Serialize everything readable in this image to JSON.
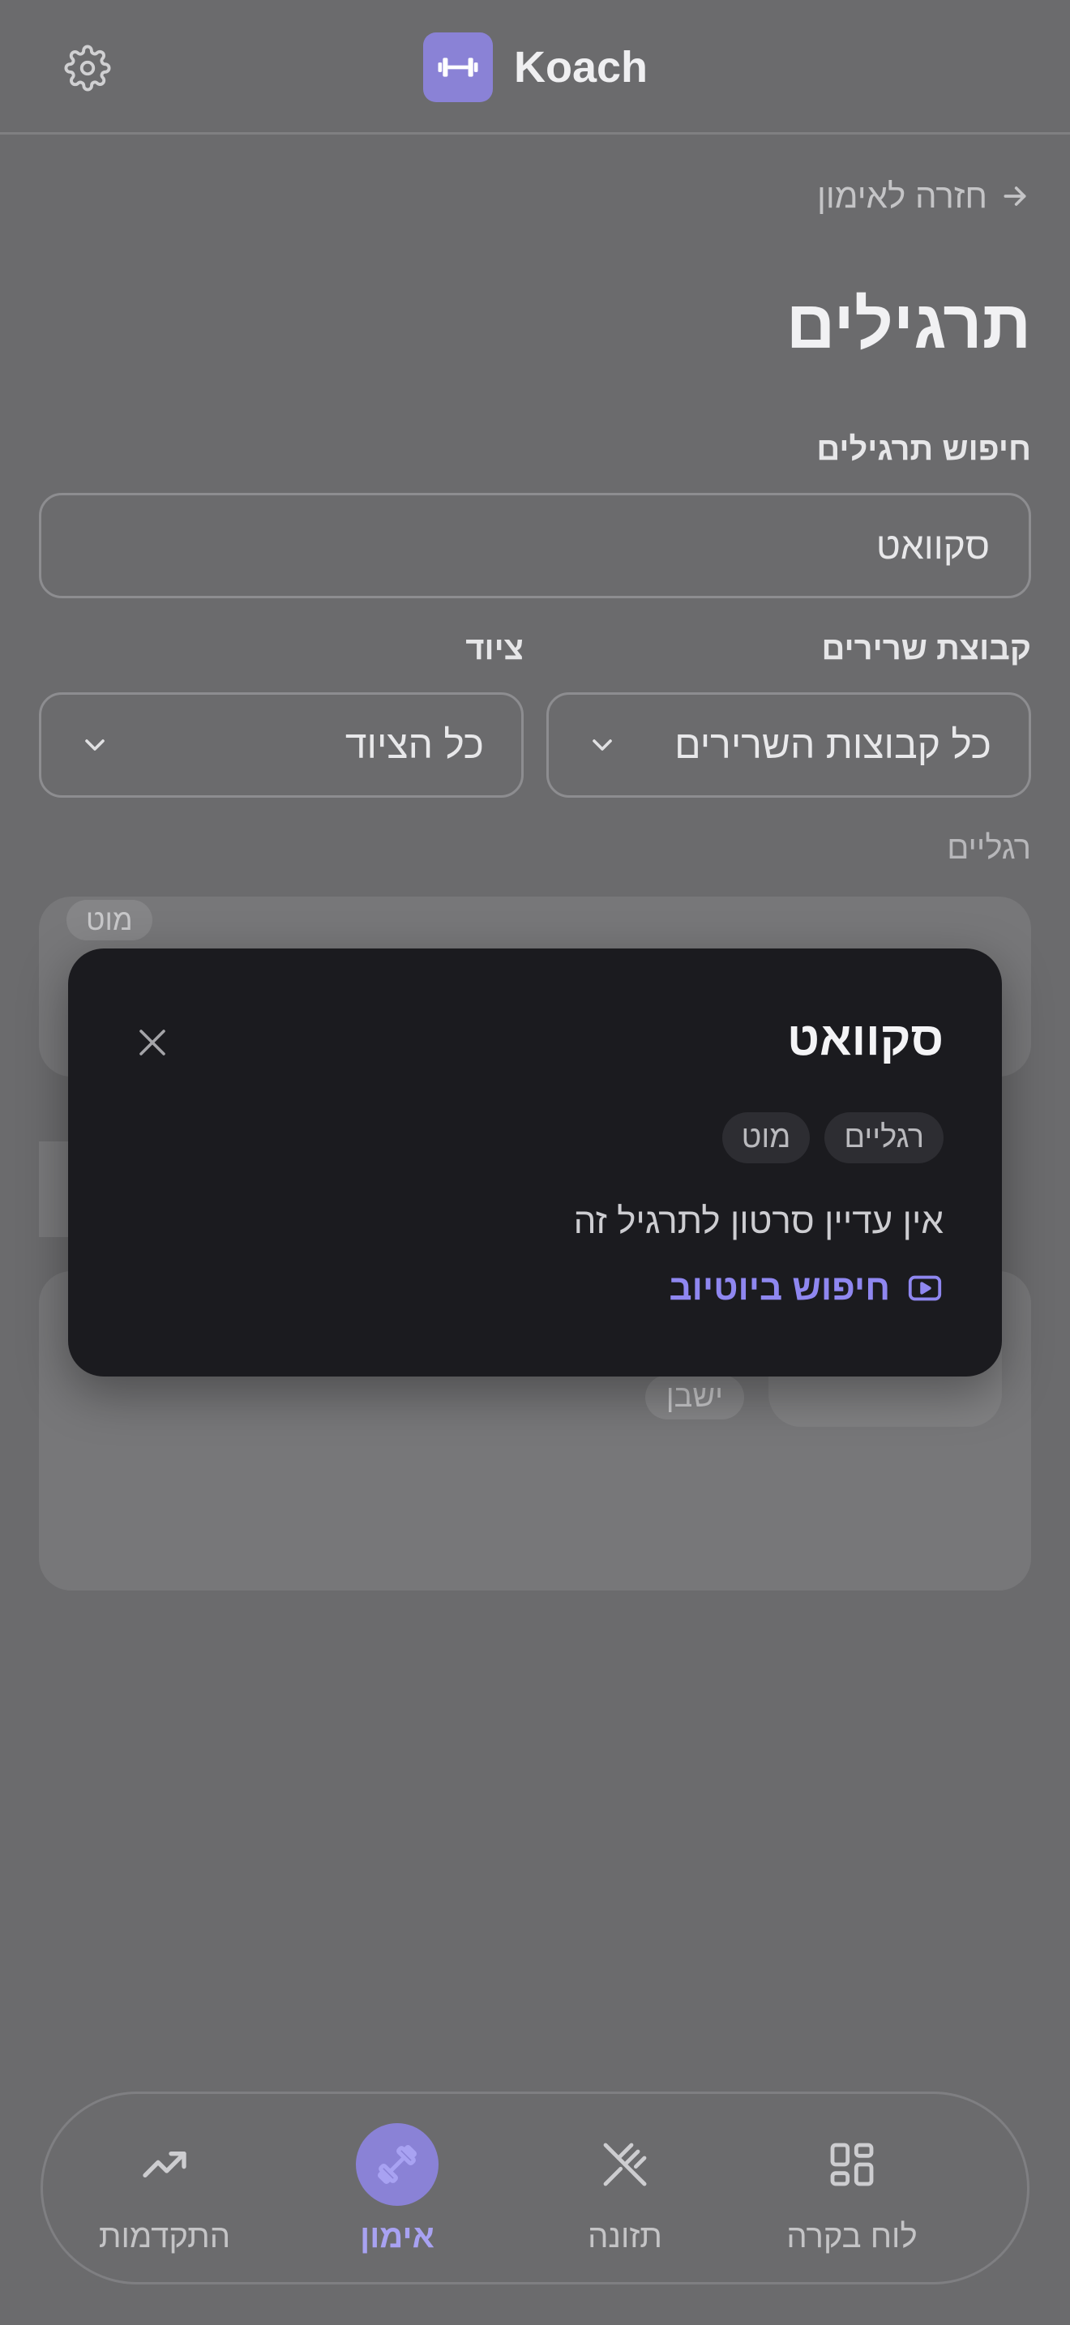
{
  "header": {
    "brand_name": "Koach",
    "icons": {
      "settings": "gear-icon",
      "logo": "dumbbell-icon"
    }
  },
  "main": {
    "back_label": "חזרה לאימון",
    "page_title": "תרגילים",
    "search": {
      "label": "חיפוש תרגילים",
      "value": "סקוואט"
    },
    "filters": {
      "muscle": {
        "label": "קבוצת שרירים",
        "selected": "כל קבוצות השרירים"
      },
      "equipment": {
        "label": "ציוד",
        "selected": "כל הציוד"
      }
    },
    "section_label": "רגליים",
    "cards": [
      {
        "tag": "מוט"
      },
      {
        "tag": "ישבן"
      }
    ]
  },
  "modal": {
    "title": "סקוואט",
    "tags": [
      "רגליים",
      "מוט"
    ],
    "message": "אין עדיין סרטון לתרגיל זה",
    "youtube_link": "חיפוש ביוטיוב"
  },
  "nav": {
    "items": [
      {
        "label": "לוח בקרה",
        "icon": "dashboard-grid-icon",
        "active": false
      },
      {
        "label": "תזונה",
        "icon": "utensils-icon",
        "active": false
      },
      {
        "label": "אימון",
        "icon": "dumbbell-icon",
        "active": true
      },
      {
        "label": "התקדמות",
        "icon": "trending-up-icon",
        "active": false
      }
    ]
  },
  "colors": {
    "accent": "#8a82d6",
    "link": "#8f87f0",
    "modal_bg": "#1b1b1f",
    "page_bg": "#6b6b6d"
  }
}
